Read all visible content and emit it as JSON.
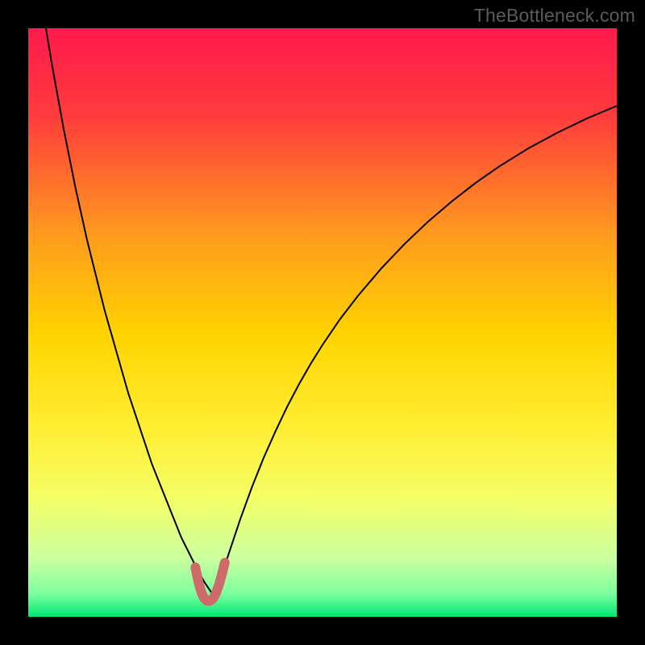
{
  "watermark": "TheBottleneck.com",
  "chart_data": {
    "type": "line",
    "title": "",
    "xlabel": "",
    "ylabel": "",
    "xlim": [
      0,
      100
    ],
    "ylim": [
      0,
      100
    ],
    "grid": false,
    "legend": false,
    "background_gradient": {
      "stops": [
        {
          "offset": 0.0,
          "color": "#ff1a4d"
        },
        {
          "offset": 0.15,
          "color": "#ff3c3c"
        },
        {
          "offset": 0.35,
          "color": "#ff9a1e"
        },
        {
          "offset": 0.52,
          "color": "#ffd400"
        },
        {
          "offset": 0.68,
          "color": "#ffee33"
        },
        {
          "offset": 0.8,
          "color": "#f4ff66"
        },
        {
          "offset": 0.9,
          "color": "#ccffa0"
        },
        {
          "offset": 0.96,
          "color": "#7eff9e"
        },
        {
          "offset": 1.0,
          "color": "#00e873"
        }
      ]
    },
    "series": [
      {
        "name": "curve",
        "color": "#000000",
        "width": 2,
        "x": [
          3,
          4,
          5,
          6,
          7,
          8,
          9,
          10,
          11,
          12,
          13,
          14,
          15,
          16,
          17,
          18,
          19,
          20,
          21,
          22,
          23,
          24,
          25,
          26,
          27,
          28,
          29,
          30,
          31,
          31.5,
          32,
          33,
          34,
          35,
          36,
          38,
          40,
          42,
          44,
          46,
          48,
          50,
          53,
          56,
          60,
          64,
          68,
          72,
          76,
          80,
          85,
          90,
          95,
          100
        ],
        "y": [
          100,
          94,
          88.5,
          83,
          78,
          73,
          68.5,
          64,
          60,
          56,
          52,
          48.5,
          45,
          41.5,
          38,
          35,
          32,
          29,
          26,
          23.5,
          21,
          18.5,
          16,
          13.5,
          11.5,
          9.5,
          7.5,
          5.8,
          4.3,
          3.6,
          4.5,
          7.5,
          10.5,
          13.5,
          16.5,
          22,
          27,
          31.5,
          35.7,
          39.5,
          43,
          46.2,
          50.6,
          54.5,
          59.2,
          63.4,
          67.2,
          70.6,
          73.7,
          76.5,
          79.6,
          82.3,
          84.7,
          86.8
        ]
      },
      {
        "name": "bottom-marker",
        "color": "#cf6a6a",
        "width": 12,
        "linecap": "round",
        "x": [
          28.4,
          28.9,
          29.4,
          29.9,
          30.4,
          30.9,
          31.4,
          31.9,
          32.4,
          32.9,
          33.4
        ],
        "y": [
          8.4,
          6.0,
          4.2,
          3.1,
          2.7,
          2.7,
          3.1,
          4.0,
          5.4,
          7.2,
          9.2
        ]
      }
    ]
  }
}
